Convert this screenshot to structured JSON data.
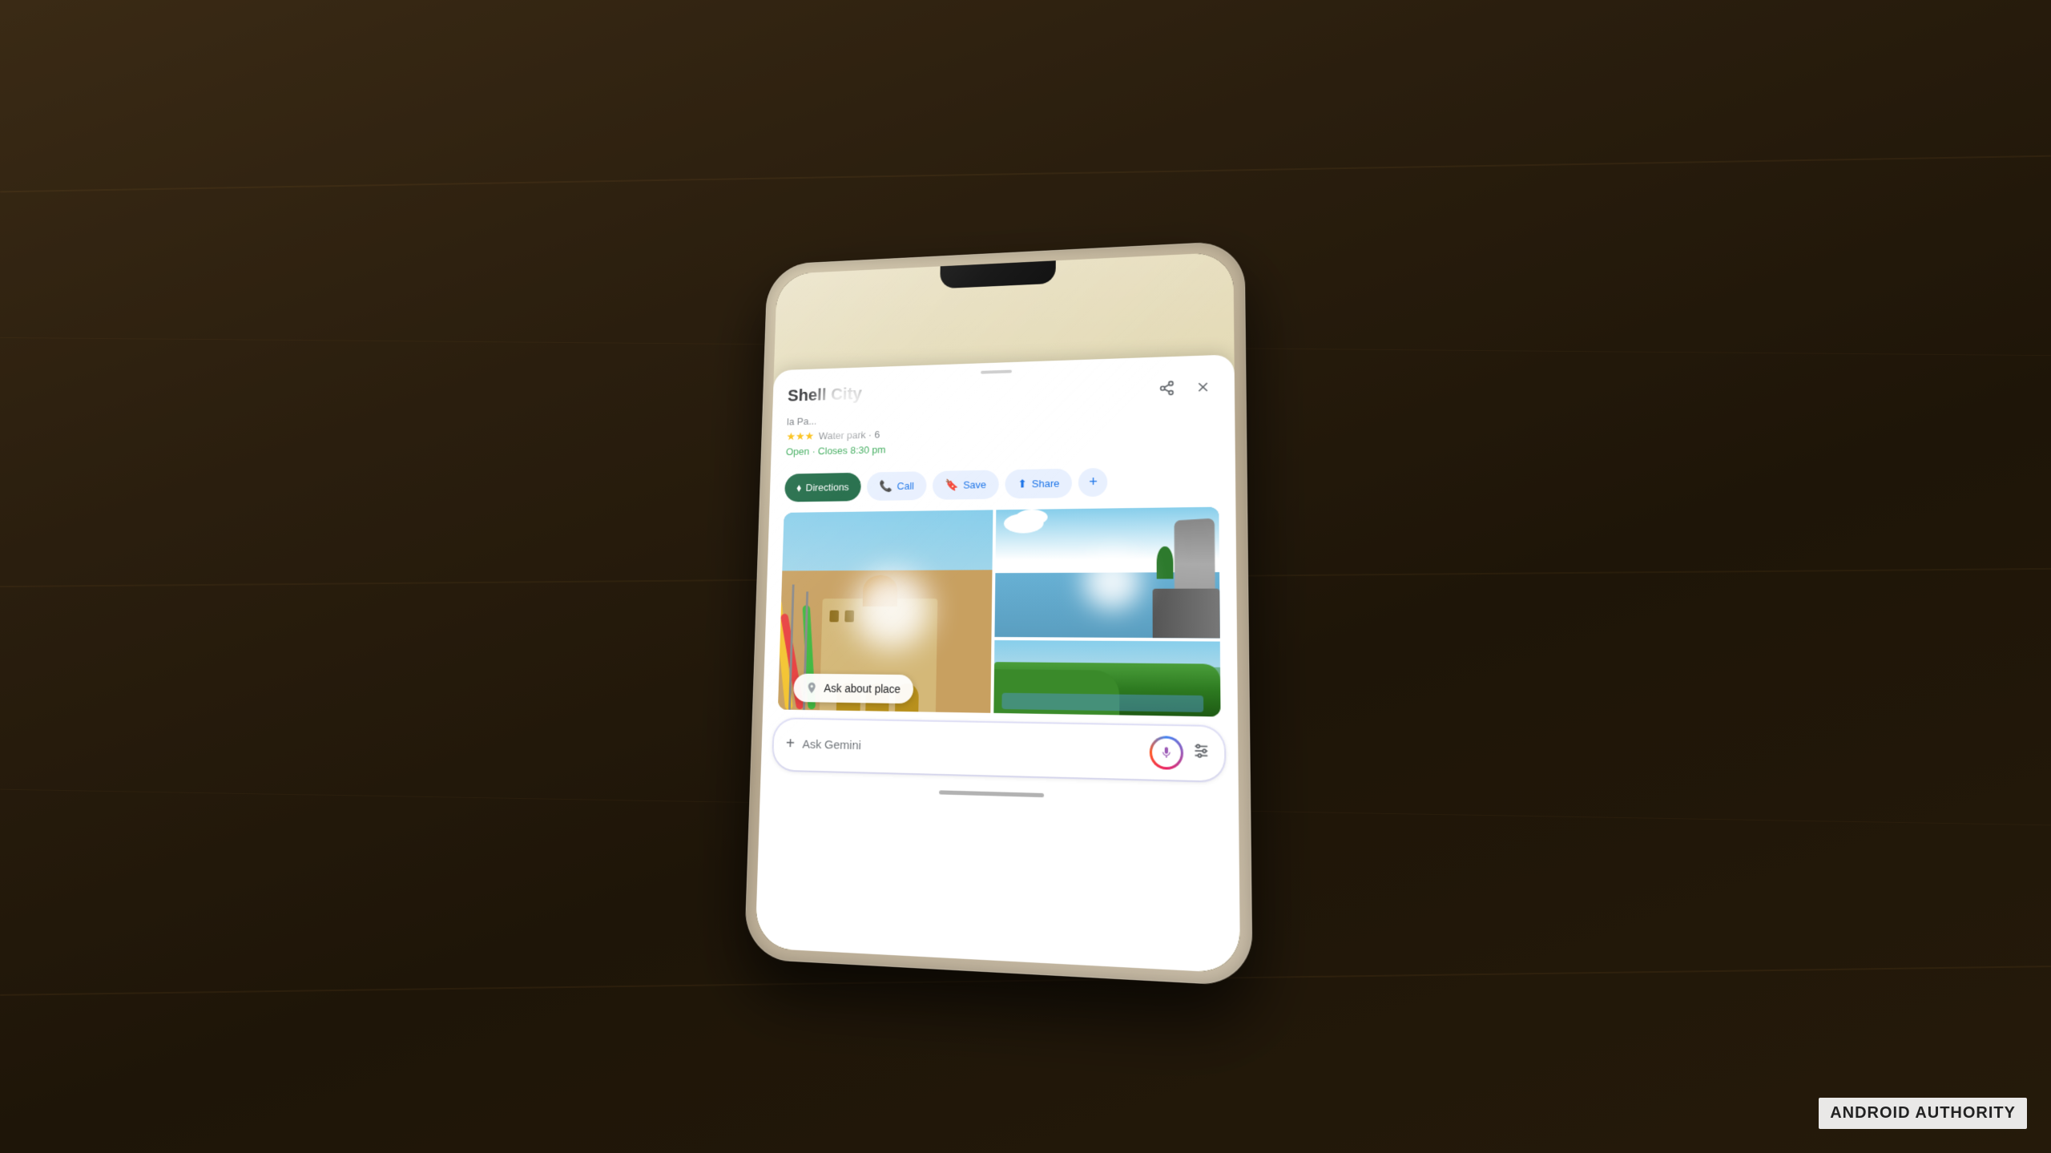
{
  "watermark": {
    "text": "ANDROID AUTHORITY"
  },
  "phone": {
    "screen": {
      "place": {
        "title": "Shell City",
        "subtitle": "la Pa...",
        "rating": "3.5",
        "stars": "★★★",
        "type": "Water park · 6",
        "status": "Open · Closes 8:30 pm"
      },
      "actions": {
        "directions": "Directions",
        "call": "Call",
        "save": "Save",
        "share": "Share",
        "more": "+"
      },
      "ask_place": {
        "label": "Ask about place",
        "icon": "📍"
      },
      "gemini_bar": {
        "placeholder": "Ask Gemini",
        "plus_label": "+",
        "mic_label": "microphone",
        "tune_label": "tune"
      },
      "header_icons": {
        "share": "share",
        "close": "✕"
      }
    }
  }
}
